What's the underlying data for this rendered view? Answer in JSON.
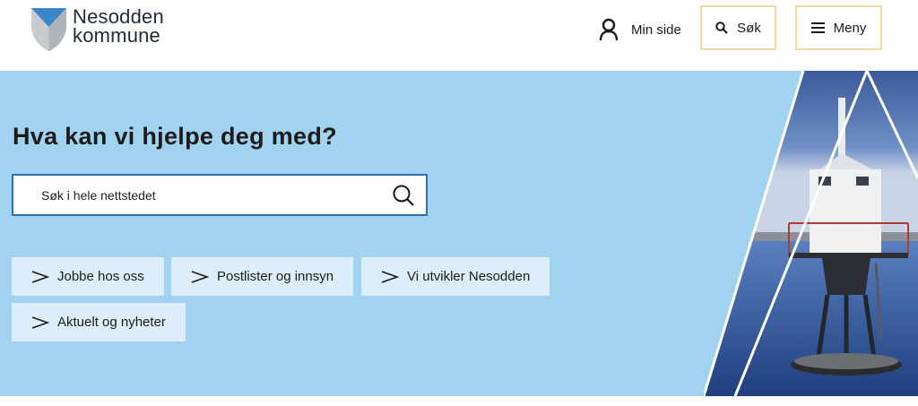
{
  "header": {
    "logo": {
      "line1": "Nesodden",
      "line2": "kommune"
    },
    "min_side": "Min side",
    "sok": "Søk",
    "meny": "Meny"
  },
  "hero": {
    "title": "Hva kan vi hjelpe deg med?",
    "search_placeholder": "Søk i hele nettstedet",
    "quick_links": [
      "Jobbe hos oss",
      "Postlister og innsyn",
      "Vi utvikler Nesodden",
      "Aktuelt og nyheter"
    ]
  },
  "colors": {
    "hero_bg": "#a1d3f0",
    "quick_link_bg": "#ddeefa",
    "button_border": "#f3d9a0",
    "search_border": "#2f6fb3"
  },
  "icons": [
    "coat-of-arms-icon",
    "user-icon",
    "search-icon",
    "menu-icon",
    "chevron-right-icon"
  ]
}
